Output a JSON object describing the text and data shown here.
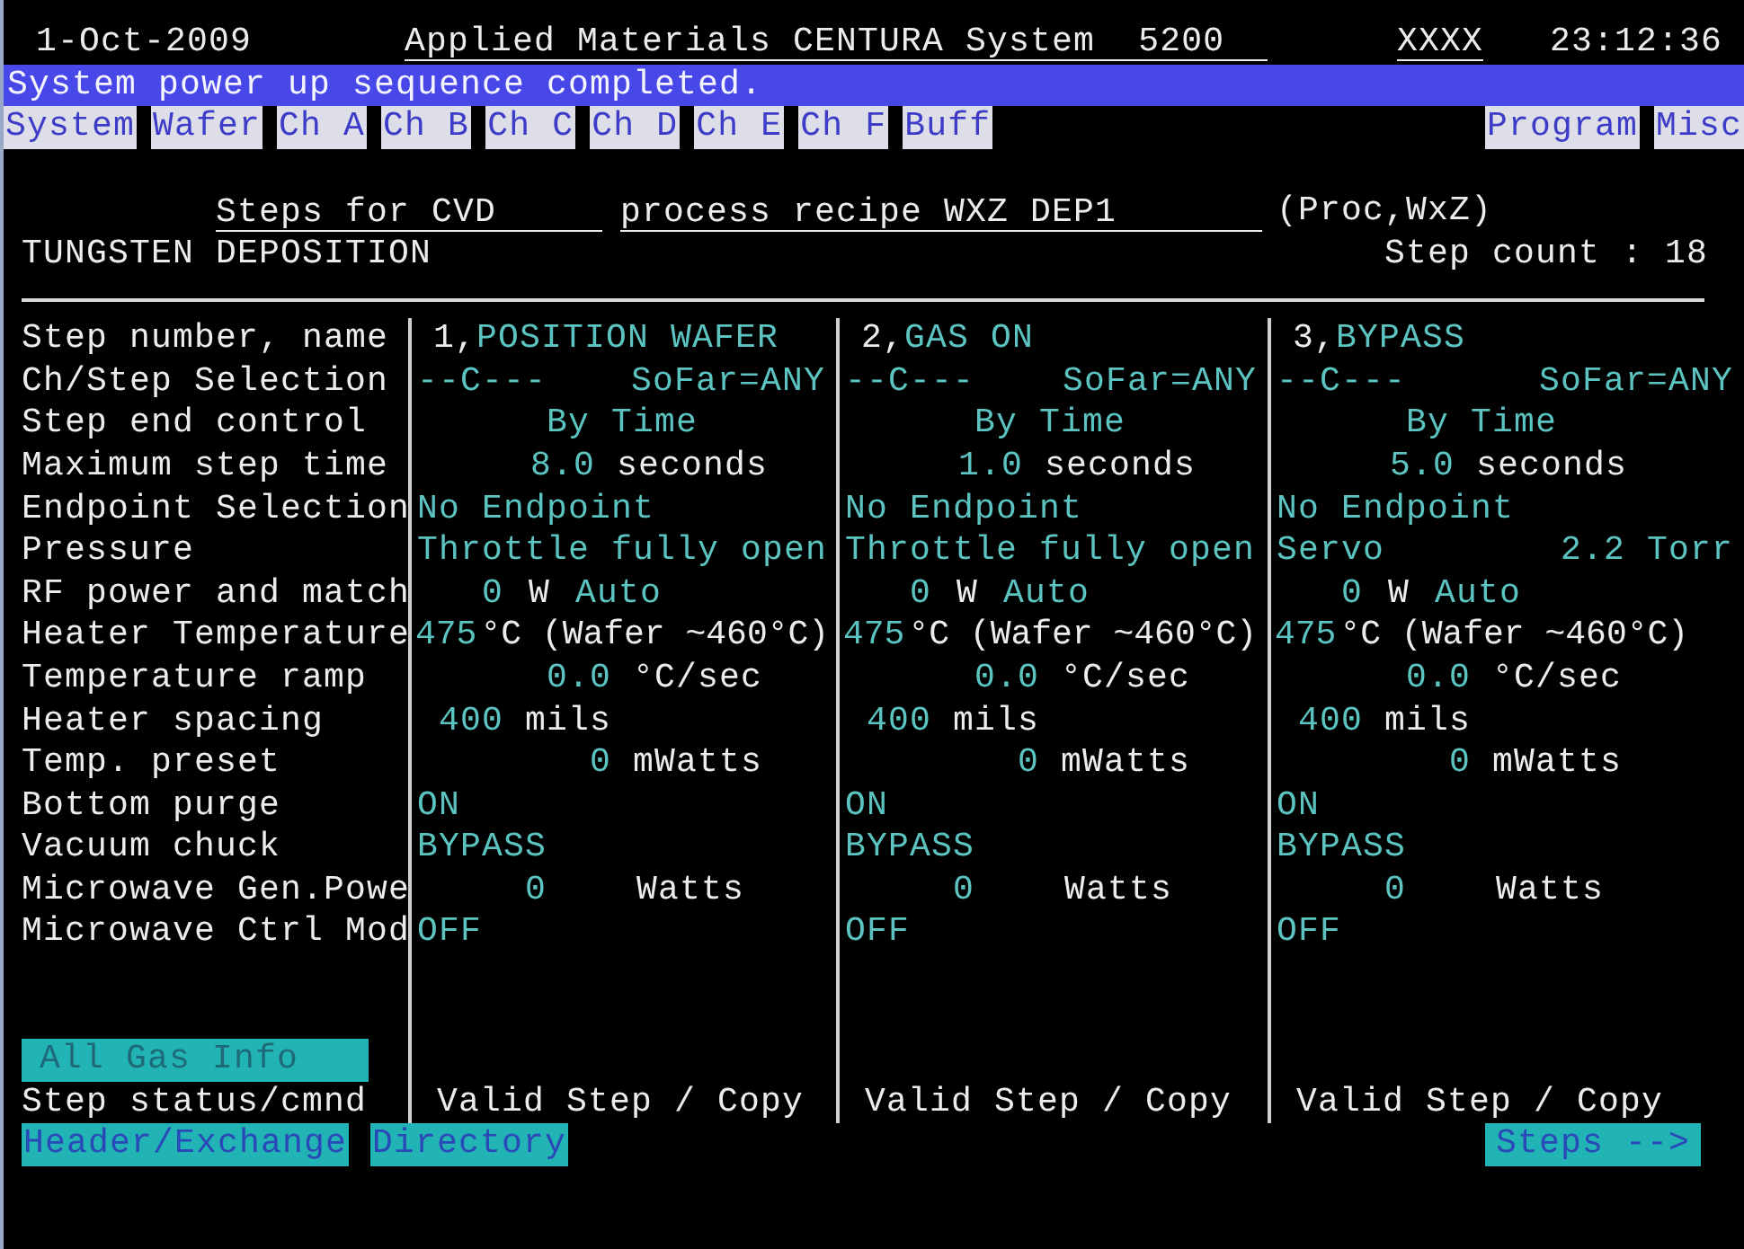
{
  "header": {
    "date": "1-Oct-2009",
    "title": "Applied Materials CENTURA System  5200",
    "user": "XXXX",
    "time": "23:12:36"
  },
  "status_message": "System power up sequence completed.",
  "menu_left": [
    "System",
    "Wafer",
    "Ch A",
    "Ch B",
    "Ch C",
    "Ch D",
    "Ch E",
    "Ch F",
    "Buff"
  ],
  "menu_right": [
    "Program",
    "Misc"
  ],
  "recipe": {
    "steps_for": "Steps for CVD",
    "recipe_name": "process recipe WXZ DEP1",
    "owner": "(Proc,WxZ)",
    "description": "TUNGSTEN DEPOSITION",
    "step_count": "Step count : 18"
  },
  "row_labels": [
    "Step number, name",
    "Ch/Step Selection",
    "Step end control",
    "Maximum step time",
    "Endpoint Selection",
    "Pressure",
    "RF power and match",
    "Heater Temperature",
    "Temperature ramp",
    "Heater spacing",
    "Temp. preset",
    "Bottom purge",
    "Vacuum chuck",
    "Microwave Gen.Powe",
    "Microwave Ctrl Mod"
  ],
  "steps": [
    {
      "rows": [
        {
          "kind": "name",
          "segments": [
            {
              "text": "1,",
              "kind": "unit"
            },
            {
              "text": "POSITION WAFER",
              "kind": "value"
            }
          ]
        },
        {
          "kind": "selection",
          "segments": [
            {
              "text": "--C---",
              "kind": "value"
            },
            {
              "text": "SoFar=ANY",
              "kind": "value"
            }
          ]
        },
        {
          "kind": "end_control",
          "segments": [
            {
              "text": "By Time",
              "kind": "value"
            }
          ]
        },
        {
          "kind": "time",
          "segments": [
            {
              "text": "8.0",
              "kind": "value"
            },
            {
              "text": "seconds",
              "kind": "unit"
            }
          ]
        },
        {
          "kind": "plain",
          "segments": [
            {
              "text": "No Endpoint",
              "kind": "value"
            }
          ]
        },
        {
          "kind": "pressure",
          "segments": [
            {
              "text": "Throttle fully open",
              "kind": "value"
            }
          ]
        },
        {
          "kind": "rf",
          "segments": [
            {
              "text": "0",
              "kind": "value"
            },
            {
              "text": "W",
              "kind": "unit"
            },
            {
              "text": "Auto",
              "kind": "value"
            }
          ]
        },
        {
          "kind": "temp",
          "segments": [
            {
              "text": "475",
              "kind": "value"
            },
            {
              "text": "°C (Wafer ~460°C)",
              "kind": "unit"
            }
          ]
        },
        {
          "kind": "ramp",
          "segments": [
            {
              "text": "0.0",
              "kind": "value"
            },
            {
              "text": "°C/sec",
              "kind": "unit"
            }
          ]
        },
        {
          "kind": "spacing",
          "segments": [
            {
              "text": "400",
              "kind": "value"
            },
            {
              "text": "mils",
              "kind": "unit"
            }
          ]
        },
        {
          "kind": "preset",
          "segments": [
            {
              "text": "0",
              "kind": "value"
            },
            {
              "text": "mWatts",
              "kind": "unit"
            }
          ]
        },
        {
          "kind": "plain",
          "segments": [
            {
              "text": "ON",
              "kind": "value"
            }
          ]
        },
        {
          "kind": "plain",
          "segments": [
            {
              "text": "BYPASS",
              "kind": "value"
            }
          ]
        },
        {
          "kind": "microwave",
          "segments": [
            {
              "text": "0",
              "kind": "value"
            },
            {
              "text": "Watts",
              "kind": "unit"
            }
          ]
        },
        {
          "kind": "plain",
          "segments": [
            {
              "text": "OFF",
              "kind": "value"
            }
          ]
        }
      ],
      "status": "Valid Step / Copy"
    },
    {
      "rows": [
        {
          "kind": "name",
          "segments": [
            {
              "text": "2,",
              "kind": "unit"
            },
            {
              "text": "GAS ON",
              "kind": "value"
            }
          ]
        },
        {
          "kind": "selection",
          "segments": [
            {
              "text": "--C---",
              "kind": "value"
            },
            {
              "text": "SoFar=ANY",
              "kind": "value"
            }
          ]
        },
        {
          "kind": "end_control",
          "segments": [
            {
              "text": "By Time",
              "kind": "value"
            }
          ]
        },
        {
          "kind": "time",
          "segments": [
            {
              "text": "1.0",
              "kind": "value"
            },
            {
              "text": "seconds",
              "kind": "unit"
            }
          ]
        },
        {
          "kind": "plain",
          "segments": [
            {
              "text": "No Endpoint",
              "kind": "value"
            }
          ]
        },
        {
          "kind": "pressure",
          "segments": [
            {
              "text": "Throttle fully open",
              "kind": "value"
            }
          ]
        },
        {
          "kind": "rf",
          "segments": [
            {
              "text": "0",
              "kind": "value"
            },
            {
              "text": "W",
              "kind": "unit"
            },
            {
              "text": "Auto",
              "kind": "value"
            }
          ]
        },
        {
          "kind": "temp",
          "segments": [
            {
              "text": "475",
              "kind": "value"
            },
            {
              "text": "°C (Wafer ~460°C)",
              "kind": "unit"
            }
          ]
        },
        {
          "kind": "ramp",
          "segments": [
            {
              "text": "0.0",
              "kind": "value"
            },
            {
              "text": "°C/sec",
              "kind": "unit"
            }
          ]
        },
        {
          "kind": "spacing",
          "segments": [
            {
              "text": "400",
              "kind": "value"
            },
            {
              "text": "mils",
              "kind": "unit"
            }
          ]
        },
        {
          "kind": "preset",
          "segments": [
            {
              "text": "0",
              "kind": "value"
            },
            {
              "text": "mWatts",
              "kind": "unit"
            }
          ]
        },
        {
          "kind": "plain",
          "segments": [
            {
              "text": "ON",
              "kind": "value"
            }
          ]
        },
        {
          "kind": "plain",
          "segments": [
            {
              "text": "BYPASS",
              "kind": "value"
            }
          ]
        },
        {
          "kind": "microwave",
          "segments": [
            {
              "text": "0",
              "kind": "value"
            },
            {
              "text": "Watts",
              "kind": "unit"
            }
          ]
        },
        {
          "kind": "plain",
          "segments": [
            {
              "text": "OFF",
              "kind": "value"
            }
          ]
        }
      ],
      "status": "Valid Step / Copy"
    },
    {
      "rows": [
        {
          "kind": "name",
          "segments": [
            {
              "text": "3,",
              "kind": "unit"
            },
            {
              "text": "BYPASS",
              "kind": "value"
            }
          ]
        },
        {
          "kind": "selection",
          "segments": [
            {
              "text": "--C---",
              "kind": "value"
            },
            {
              "text": "SoFar=ANY",
              "kind": "value"
            }
          ]
        },
        {
          "kind": "end_control",
          "segments": [
            {
              "text": "By Time",
              "kind": "value"
            }
          ]
        },
        {
          "kind": "time",
          "segments": [
            {
              "text": "5.0",
              "kind": "value"
            },
            {
              "text": "seconds",
              "kind": "unit"
            }
          ]
        },
        {
          "kind": "plain",
          "segments": [
            {
              "text": "No Endpoint",
              "kind": "value"
            }
          ]
        },
        {
          "kind": "pressure",
          "segments": [
            {
              "text": "Servo",
              "kind": "value"
            },
            {
              "text": "2.2 Torr",
              "kind": "value"
            }
          ]
        },
        {
          "kind": "rf",
          "segments": [
            {
              "text": "0",
              "kind": "value"
            },
            {
              "text": "W",
              "kind": "unit"
            },
            {
              "text": "Auto",
              "kind": "value"
            }
          ]
        },
        {
          "kind": "temp",
          "segments": [
            {
              "text": "475",
              "kind": "value"
            },
            {
              "text": "°C (Wafer ~460°C)",
              "kind": "unit"
            }
          ]
        },
        {
          "kind": "ramp",
          "segments": [
            {
              "text": "0.0",
              "kind": "value"
            },
            {
              "text": "°C/sec",
              "kind": "unit"
            }
          ]
        },
        {
          "kind": "spacing",
          "segments": [
            {
              "text": "400",
              "kind": "value"
            },
            {
              "text": "mils",
              "kind": "unit"
            }
          ]
        },
        {
          "kind": "preset",
          "segments": [
            {
              "text": "0",
              "kind": "value"
            },
            {
              "text": "mWatts",
              "kind": "unit"
            }
          ]
        },
        {
          "kind": "plain",
          "segments": [
            {
              "text": "ON",
              "kind": "value"
            }
          ]
        },
        {
          "kind": "plain",
          "segments": [
            {
              "text": "BYPASS",
              "kind": "value"
            }
          ]
        },
        {
          "kind": "microwave",
          "segments": [
            {
              "text": "0",
              "kind": "value"
            },
            {
              "text": "Watts",
              "kind": "unit"
            }
          ]
        },
        {
          "kind": "plain",
          "segments": [
            {
              "text": "OFF",
              "kind": "value"
            }
          ]
        }
      ],
      "status": "Valid Step / Copy"
    }
  ],
  "all_gas_button": "All Gas Info",
  "status_label": "Step status/cmnd",
  "footer_left": [
    "Header/Exchange",
    "Directory"
  ],
  "footer_right": "Steps -->"
}
